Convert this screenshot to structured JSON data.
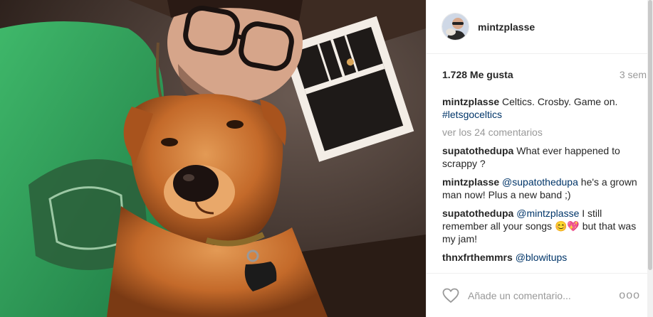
{
  "post": {
    "username": "mintzplasse",
    "likes": "1.728 Me gusta",
    "time": "3 sem",
    "caption_author": "mintzplasse",
    "caption_text": "Celtics. Crosby. Game on.",
    "caption_tag": "#letsgoceltics",
    "view_all": "ver los 24 comentarios"
  },
  "comments": [
    {
      "author": "supatothedupa",
      "mention": "",
      "text": "What ever happened to scrappy ?"
    },
    {
      "author": "mintzplasse",
      "mention": "@supatothedupa",
      "text": "he's a grown man now! Plus a new band ;)"
    },
    {
      "author": "supatothedupa",
      "mention": "@mintzplasse",
      "text": "I still remember all your songs 😊💖 but that was my jam!"
    },
    {
      "author": "thnxfrthemmrs",
      "mention": "@blowitups",
      "text": ""
    }
  ],
  "footer": {
    "placeholder": "Añade un comentario...",
    "options": "ooo"
  },
  "colors": {
    "accent_link": "#003569",
    "muted": "#999999",
    "border": "#efefef"
  },
  "icons": {
    "like": "heart-outline-icon",
    "options": "more-dots-icon"
  }
}
